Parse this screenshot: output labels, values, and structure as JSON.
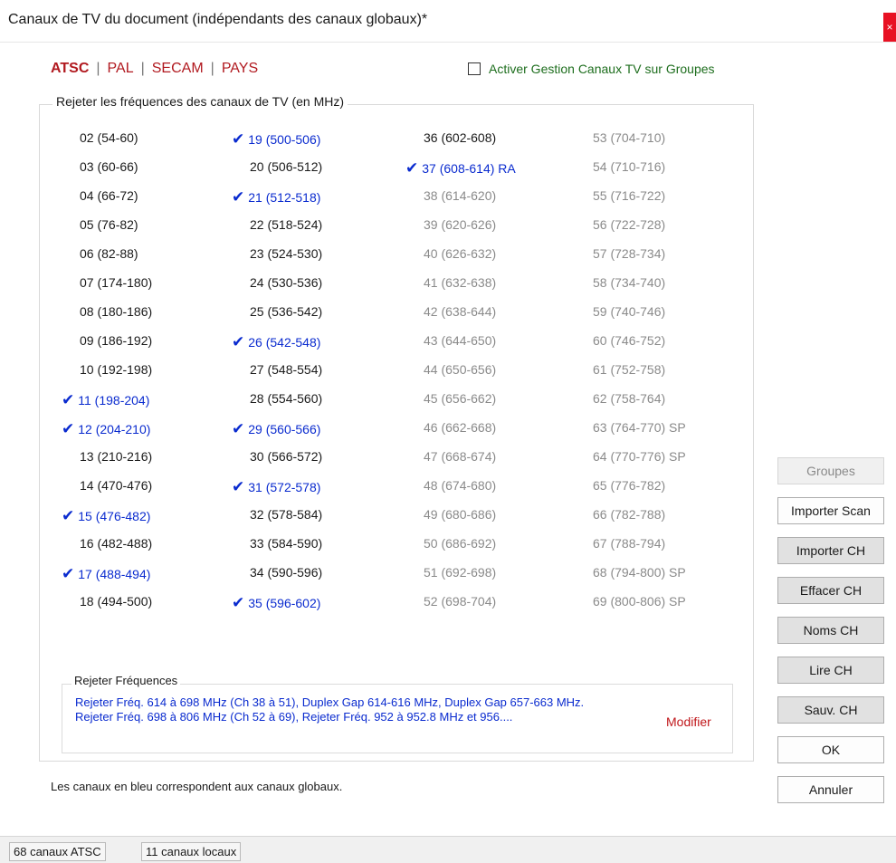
{
  "window": {
    "title": "Canaux de TV du document (indépendants des canaux globaux)*",
    "close_glyph": "×"
  },
  "standards": [
    "ATSC",
    "PAL",
    "SECAM",
    "PAYS"
  ],
  "tv_management_checkbox": {
    "label": "Activer Gestion Canaux TV sur Groupes",
    "checked": false
  },
  "group_legend": "Rejeter les fréquences des canaux de TV (en MHz)",
  "channels": {
    "columns": [
      [
        {
          "label": "02 (54-60)",
          "checked": false,
          "state": "local"
        },
        {
          "label": "03 (60-66)",
          "checked": false,
          "state": "local"
        },
        {
          "label": "04 (66-72)",
          "checked": false,
          "state": "local"
        },
        {
          "label": "05 (76-82)",
          "checked": false,
          "state": "local"
        },
        {
          "label": "06 (82-88)",
          "checked": false,
          "state": "local"
        },
        {
          "label": "07 (174-180)",
          "checked": false,
          "state": "local"
        },
        {
          "label": "08 (180-186)",
          "checked": false,
          "state": "local"
        },
        {
          "label": "09 (186-192)",
          "checked": false,
          "state": "local"
        },
        {
          "label": "10 (192-198)",
          "checked": false,
          "state": "local"
        },
        {
          "label": "11 (198-204)",
          "checked": true,
          "state": "global"
        },
        {
          "label": "12 (204-210)",
          "checked": true,
          "state": "global"
        },
        {
          "label": "13 (210-216)",
          "checked": false,
          "state": "local"
        },
        {
          "label": "14 (470-476)",
          "checked": false,
          "state": "local"
        },
        {
          "label": "15 (476-482)",
          "checked": true,
          "state": "global"
        },
        {
          "label": "16 (482-488)",
          "checked": false,
          "state": "local"
        },
        {
          "label": "17 (488-494)",
          "checked": true,
          "state": "global"
        },
        {
          "label": "18 (494-500)",
          "checked": false,
          "state": "local"
        }
      ],
      [
        {
          "label": "19 (500-506)",
          "checked": true,
          "state": "global"
        },
        {
          "label": "20 (506-512)",
          "checked": false,
          "state": "local"
        },
        {
          "label": "21 (512-518)",
          "checked": true,
          "state": "global"
        },
        {
          "label": "22 (518-524)",
          "checked": false,
          "state": "local"
        },
        {
          "label": "23 (524-530)",
          "checked": false,
          "state": "local"
        },
        {
          "label": "24 (530-536)",
          "checked": false,
          "state": "local"
        },
        {
          "label": "25 (536-542)",
          "checked": false,
          "state": "local"
        },
        {
          "label": "26 (542-548)",
          "checked": true,
          "state": "global"
        },
        {
          "label": "27 (548-554)",
          "checked": false,
          "state": "local"
        },
        {
          "label": "28 (554-560)",
          "checked": false,
          "state": "local"
        },
        {
          "label": "29 (560-566)",
          "checked": true,
          "state": "global"
        },
        {
          "label": "30 (566-572)",
          "checked": false,
          "state": "local"
        },
        {
          "label": "31 (572-578)",
          "checked": true,
          "state": "global"
        },
        {
          "label": "32 (578-584)",
          "checked": false,
          "state": "local"
        },
        {
          "label": "33 (584-590)",
          "checked": false,
          "state": "local"
        },
        {
          "label": "34 (590-596)",
          "checked": false,
          "state": "local"
        },
        {
          "label": "35 (596-602)",
          "checked": true,
          "state": "global"
        }
      ],
      [
        {
          "label": "36 (602-608)",
          "checked": false,
          "state": "local"
        },
        {
          "label": "37 (608-614) RA",
          "checked": true,
          "state": "global"
        },
        {
          "label": "38 (614-620)",
          "checked": false,
          "state": "disabled"
        },
        {
          "label": "39 (620-626)",
          "checked": false,
          "state": "disabled"
        },
        {
          "label": "40 (626-632)",
          "checked": false,
          "state": "disabled"
        },
        {
          "label": "41 (632-638)",
          "checked": false,
          "state": "disabled"
        },
        {
          "label": "42 (638-644)",
          "checked": false,
          "state": "disabled"
        },
        {
          "label": "43 (644-650)",
          "checked": false,
          "state": "disabled"
        },
        {
          "label": "44 (650-656)",
          "checked": false,
          "state": "disabled"
        },
        {
          "label": "45 (656-662)",
          "checked": false,
          "state": "disabled"
        },
        {
          "label": "46 (662-668)",
          "checked": false,
          "state": "disabled"
        },
        {
          "label": "47 (668-674)",
          "checked": false,
          "state": "disabled"
        },
        {
          "label": "48 (674-680)",
          "checked": false,
          "state": "disabled"
        },
        {
          "label": "49 (680-686)",
          "checked": false,
          "state": "disabled"
        },
        {
          "label": "50 (686-692)",
          "checked": false,
          "state": "disabled"
        },
        {
          "label": "51 (692-698)",
          "checked": false,
          "state": "disabled"
        },
        {
          "label": "52 (698-704)",
          "checked": false,
          "state": "disabled"
        }
      ],
      [
        {
          "label": "53 (704-710)",
          "checked": false,
          "state": "disabled"
        },
        {
          "label": "54 (710-716)",
          "checked": false,
          "state": "disabled"
        },
        {
          "label": "55 (716-722)",
          "checked": false,
          "state": "disabled"
        },
        {
          "label": "56 (722-728)",
          "checked": false,
          "state": "disabled"
        },
        {
          "label": "57 (728-734)",
          "checked": false,
          "state": "disabled"
        },
        {
          "label": "58 (734-740)",
          "checked": false,
          "state": "disabled"
        },
        {
          "label": "59 (740-746)",
          "checked": false,
          "state": "disabled"
        },
        {
          "label": "60 (746-752)",
          "checked": false,
          "state": "disabled"
        },
        {
          "label": "61 (752-758)",
          "checked": false,
          "state": "disabled"
        },
        {
          "label": "62 (758-764)",
          "checked": false,
          "state": "disabled"
        },
        {
          "label": "63 (764-770) SP",
          "checked": false,
          "state": "disabled"
        },
        {
          "label": "64 (770-776) SP",
          "checked": false,
          "state": "disabled"
        },
        {
          "label": "65 (776-782)",
          "checked": false,
          "state": "disabled"
        },
        {
          "label": "66 (782-788)",
          "checked": false,
          "state": "disabled"
        },
        {
          "label": "67 (788-794)",
          "checked": false,
          "state": "disabled"
        },
        {
          "label": "68 (794-800) SP",
          "checked": false,
          "state": "disabled"
        },
        {
          "label": "69 (800-806) SP",
          "checked": false,
          "state": "disabled"
        }
      ]
    ]
  },
  "reject_frequencies": {
    "legend": "Rejeter Fréquences",
    "line1": "Rejeter Fréq. 614 à 698 MHz (Ch 38 à 51), Duplex Gap 614-616 MHz, Duplex Gap 657-663 MHz.",
    "line2": "Rejeter Fréq. 698 à 806 MHz (Ch 52 à 69), Rejeter Fréq. 952 à 952.8 MHz et 956....",
    "modify_label": "Modifier"
  },
  "info_text": "Les canaux en bleu correspondent aux canaux globaux.",
  "buttons": {
    "groupes": "Groupes",
    "importer_scan": "Importer Scan",
    "importer_ch": "Importer CH",
    "effacer_ch": "Effacer CH",
    "noms_ch": "Noms CH",
    "lire_ch": "Lire CH",
    "sauv_ch": "Sauv. CH",
    "ok": "OK",
    "annuler": "Annuler"
  },
  "status": {
    "atsc_count": "68 canaux ATSC",
    "local_count": "11 canaux locaux"
  },
  "colors": {
    "global": "#0a2bcf",
    "local": "#1a1a1a",
    "disabled": "#8a8a8a",
    "accent_red": "#b1191f",
    "checkbox_label": "#1e6e1e"
  }
}
